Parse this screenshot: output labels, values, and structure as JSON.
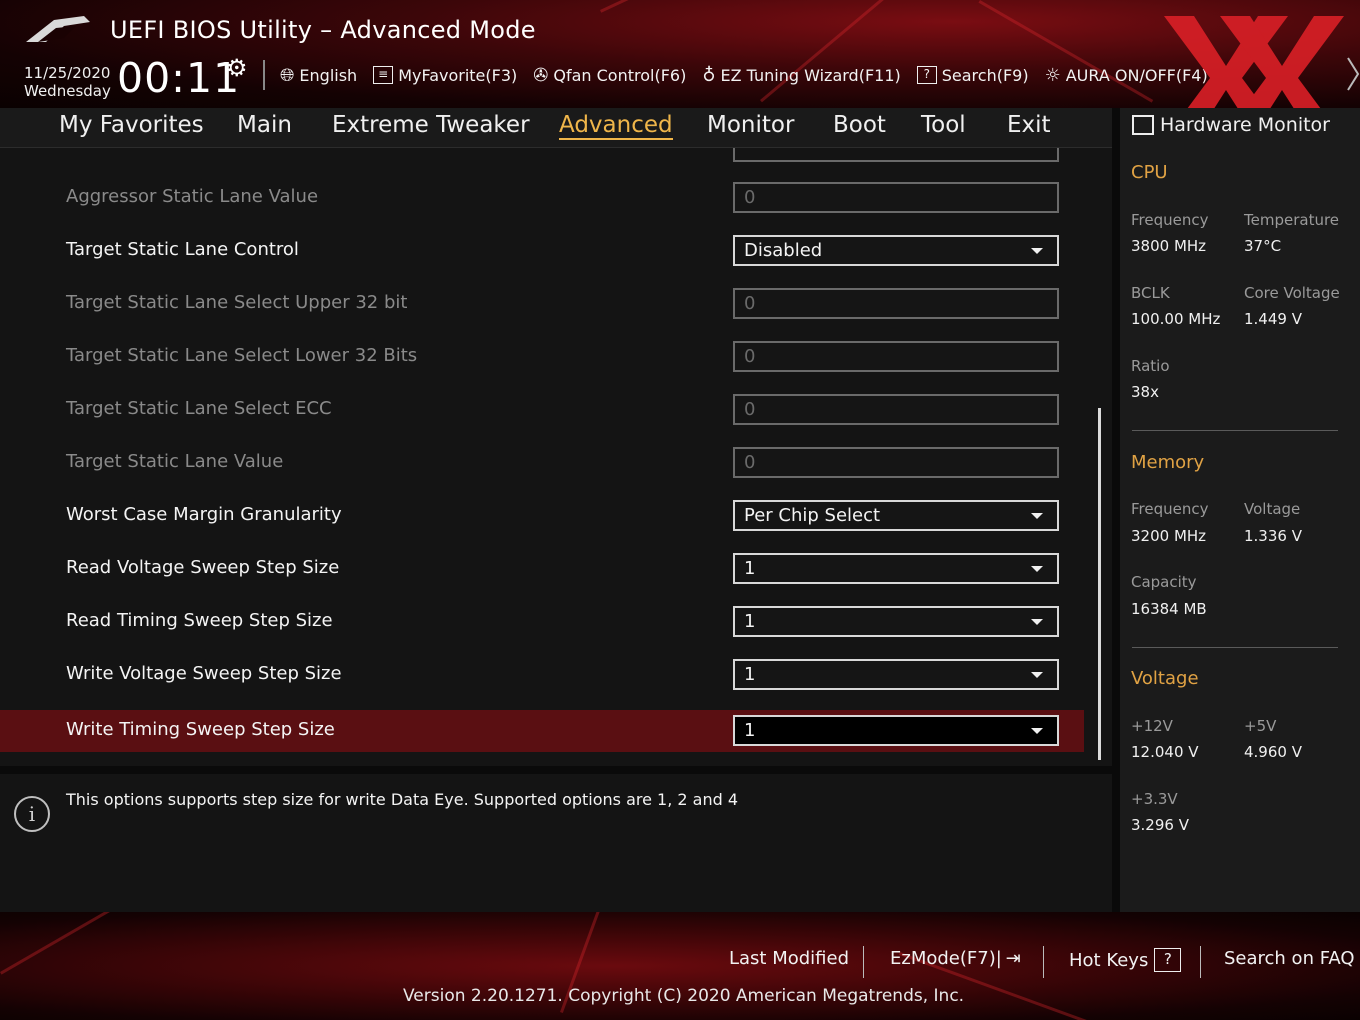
{
  "header": {
    "title": "UEFI BIOS Utility – Advanced Mode",
    "date": "11/25/2020",
    "weekday": "Wednesday",
    "time": "00:11",
    "tools": [
      {
        "label": "English",
        "icon": "globe-icon"
      },
      {
        "label": "MyFavorite(F3)",
        "icon": "favorite-list-icon"
      },
      {
        "label": "Qfan Control(F6)",
        "icon": "fan-icon"
      },
      {
        "label": "EZ Tuning Wizard(F11)",
        "icon": "lightbulb-icon"
      },
      {
        "label": "Search(F9)",
        "icon": "search-help-icon"
      },
      {
        "label": "AURA ON/OFF(F4)",
        "icon": "aura-light-icon"
      }
    ]
  },
  "nav": {
    "tabs": [
      "My Favorites",
      "Main",
      "Extreme Tweaker",
      "Advanced",
      "Monitor",
      "Boot",
      "Tool",
      "Exit"
    ],
    "active": "Advanced"
  },
  "settings": [
    {
      "label": "Aggressor Static Lane Value",
      "value": "0",
      "type": "input",
      "enabled": false
    },
    {
      "label": "Target Static Lane Control",
      "value": "Disabled",
      "type": "select",
      "enabled": true
    },
    {
      "label": "Target Static Lane Select Upper 32 bit",
      "value": "0",
      "type": "input",
      "enabled": false
    },
    {
      "label": "Target Static Lane Select Lower 32 Bits",
      "value": "0",
      "type": "input",
      "enabled": false
    },
    {
      "label": "Target Static Lane Select ECC",
      "value": "0",
      "type": "input",
      "enabled": false
    },
    {
      "label": "Target Static Lane Value",
      "value": "0",
      "type": "input",
      "enabled": false
    },
    {
      "label": "Worst Case Margin Granularity",
      "value": "Per Chip Select",
      "type": "select",
      "enabled": true
    },
    {
      "label": "Read Voltage Sweep Step Size",
      "value": "1",
      "type": "select",
      "enabled": true
    },
    {
      "label": "Read Timing Sweep Step Size",
      "value": "1",
      "type": "select",
      "enabled": true
    },
    {
      "label": "Write Voltage Sweep Step Size",
      "value": "1",
      "type": "select",
      "enabled": true
    },
    {
      "label": "Write Timing Sweep Step Size",
      "value": "1",
      "type": "select",
      "enabled": true,
      "selected": true
    }
  ],
  "help": {
    "text": "This options supports step size for write Data Eye. Supported options are 1, 2 and 4"
  },
  "hardware_monitor": {
    "title": "Hardware Monitor",
    "cpu": {
      "heading": "CPU",
      "frequency_label": "Frequency",
      "frequency": "3800 MHz",
      "temperature_label": "Temperature",
      "temperature": "37°C",
      "bclk_label": "BCLK",
      "bclk": "100.00 MHz",
      "core_voltage_label": "Core Voltage",
      "core_voltage": "1.449 V",
      "ratio_label": "Ratio",
      "ratio": "38x"
    },
    "memory": {
      "heading": "Memory",
      "frequency_label": "Frequency",
      "frequency": "3200 MHz",
      "voltage_label": "Voltage",
      "voltage": "1.336 V",
      "capacity_label": "Capacity",
      "capacity": "16384 MB"
    },
    "voltage": {
      "heading": "Voltage",
      "v12_label": "+12V",
      "v12": "12.040 V",
      "v5_label": "+5V",
      "v5": "4.960 V",
      "v33_label": "+3.3V",
      "v33": "3.296 V"
    }
  },
  "footer": {
    "last_modified": "Last Modified",
    "ezmode": "EzMode(F7)|",
    "hot_keys": "Hot Keys",
    "hot_keys_key": "?",
    "search_faq": "Search on FAQ",
    "version": "Version 2.20.1271. Copyright (C) 2020 American Megatrends, Inc."
  },
  "colors": {
    "accent": "#f0b64a",
    "section_heading": "#e0a244",
    "highlight_row": "#5a0f12",
    "header_red": "#7a0d12"
  }
}
